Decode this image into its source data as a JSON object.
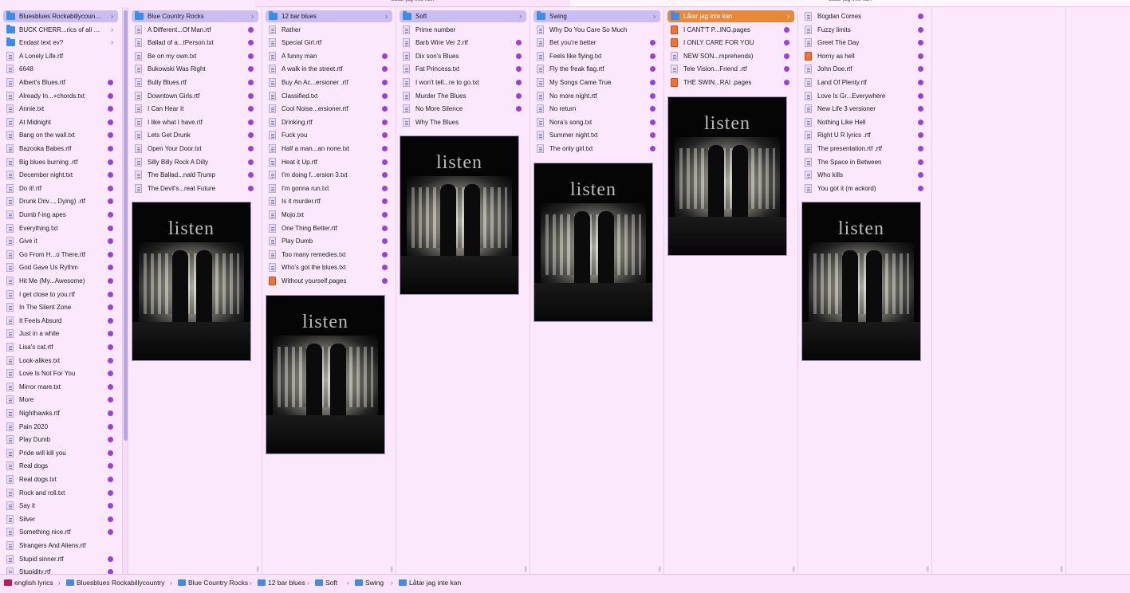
{
  "window": {
    "top_header_left": "Låtar jag inte kan",
    "top_header_right": "Låtar jag inte kan"
  },
  "colors": {
    "accent_tag": "#9b3fe0",
    "selection": "#c9bdf3",
    "selection_active": "#e8893a",
    "folder": "#3a8ee8"
  },
  "col0": {
    "items": [
      {
        "label": "Bluesblues Rockabillycountry",
        "kind": "folder",
        "chev": "›",
        "sel": true
      },
      {
        "label": "BUCK CHERR...rics of all sorts",
        "kind": "folder",
        "chev": "›"
      },
      {
        "label": "Endast text ev?",
        "kind": "folder",
        "chev": "›"
      },
      {
        "label": "A Lonely Life.rtf",
        "kind": "doc"
      },
      {
        "label": "6648",
        "kind": "doc"
      },
      {
        "label": "Albert's Blues.rtf",
        "kind": "doc",
        "tag": true
      },
      {
        "label": "Already In...+chords.txt",
        "kind": "doc",
        "tag": true
      },
      {
        "label": "Annie.txt",
        "kind": "doc",
        "tag": true
      },
      {
        "label": "At Midnight",
        "kind": "doc",
        "tag": true
      },
      {
        "label": "Bang on the wall.txt",
        "kind": "doc",
        "tag": true
      },
      {
        "label": "Bazooka Babes.rtf",
        "kind": "doc",
        "tag": true
      },
      {
        "label": "Big blues burning .rtf",
        "kind": "doc",
        "tag": true
      },
      {
        "label": "December night.txt",
        "kind": "doc",
        "tag": true
      },
      {
        "label": "Do it!.rtf",
        "kind": "doc",
        "tag": true
      },
      {
        "label": "Drunk Driv..., Dying) .rtf",
        "kind": "doc",
        "tag": true
      },
      {
        "label": "Dumb f-ing apes",
        "kind": "doc",
        "tag": true
      },
      {
        "label": "Everything.txt",
        "kind": "doc",
        "tag": true
      },
      {
        "label": "Give it",
        "kind": "doc",
        "tag": true
      },
      {
        "label": "Go From H...o There.rtf",
        "kind": "doc",
        "tag": true
      },
      {
        "label": "God Gave Us Rythm",
        "kind": "doc",
        "tag": true
      },
      {
        "label": "Hit Me (My...Awesome)",
        "kind": "doc",
        "tag": true
      },
      {
        "label": "I get close to you.rtf",
        "kind": "doc",
        "tag": true
      },
      {
        "label": "In The Silent Zone",
        "kind": "doc",
        "tag": true
      },
      {
        "label": "It Feels Absurd",
        "kind": "doc",
        "tag": true
      },
      {
        "label": "Just in a while",
        "kind": "doc",
        "tag": true
      },
      {
        "label": "Lisa's cat.rtf",
        "kind": "doc",
        "tag": true
      },
      {
        "label": "Look-alikes.txt",
        "kind": "doc",
        "tag": true
      },
      {
        "label": "Love Is Not For You",
        "kind": "doc",
        "tag": true
      },
      {
        "label": "Mirror mare.txt",
        "kind": "doc",
        "tag": true
      },
      {
        "label": "More",
        "kind": "doc",
        "tag": true
      },
      {
        "label": "Nighthawks.rtf",
        "kind": "doc",
        "tag": true
      },
      {
        "label": "Pain 2020",
        "kind": "doc",
        "tag": true
      },
      {
        "label": "Play Dumb",
        "kind": "doc",
        "tag": true
      },
      {
        "label": "Pride will kill you",
        "kind": "doc",
        "tag": true
      },
      {
        "label": "Real dogs",
        "kind": "doc",
        "tag": true
      },
      {
        "label": "Real dogs.txt",
        "kind": "doc",
        "tag": true
      },
      {
        "label": "Rock and roll.txt",
        "kind": "doc",
        "tag": true
      },
      {
        "label": "Say it",
        "kind": "doc",
        "tag": true
      },
      {
        "label": "Silver",
        "kind": "doc",
        "tag": true
      },
      {
        "label": "Something nice.rtf",
        "kind": "doc",
        "tag": true
      },
      {
        "label": "Strangers And Aliens.rtf",
        "kind": "doc"
      },
      {
        "label": "Stupid sinner.rtf",
        "kind": "doc",
        "tag": true
      },
      {
        "label": "Stupidity.rtf",
        "kind": "doc",
        "tag": true
      }
    ]
  },
  "col1": {
    "items": [
      {
        "label": "Blue Country Rocks",
        "kind": "folder",
        "chev": "›",
        "sel": true
      },
      {
        "label": "A Different...Of Man.rtf",
        "kind": "doc",
        "tag": true
      },
      {
        "label": "Ballad of a...tPerson.txt",
        "kind": "doc",
        "tag": true
      },
      {
        "label": "Be on my own.txt",
        "kind": "doc",
        "tag": true
      },
      {
        "label": "Bukowski Was Right",
        "kind": "doc",
        "tag": true
      },
      {
        "label": "Bully Blues.rtf",
        "kind": "doc",
        "tag": true
      },
      {
        "label": "Downtown Girls.rtf",
        "kind": "doc",
        "tag": true
      },
      {
        "label": "I Can Hear It",
        "kind": "doc",
        "tag": true
      },
      {
        "label": "I like what I have.rtf",
        "kind": "doc",
        "tag": true
      },
      {
        "label": "Lets Get Drunk",
        "kind": "doc",
        "tag": true
      },
      {
        "label": "Open Your Door.txt",
        "kind": "doc",
        "tag": true
      },
      {
        "label": "Silly Billy Rock A Dilly",
        "kind": "doc",
        "tag": true
      },
      {
        "label": "The Ballad...nald Trump",
        "kind": "doc",
        "tag": true
      },
      {
        "label": "The Devil's...reat Future",
        "kind": "doc",
        "tag": true
      }
    ],
    "preview_title": "listen"
  },
  "col2": {
    "items": [
      {
        "label": "12 bar blues",
        "kind": "folder",
        "chev": "›",
        "sel": true
      },
      {
        "label": "Rather",
        "kind": "doc"
      },
      {
        "label": "Special Girl.rtf",
        "kind": "doc"
      },
      {
        "label": "A funny man",
        "kind": "doc",
        "tag": true
      },
      {
        "label": "A walk in the street.rtf",
        "kind": "doc",
        "tag": true
      },
      {
        "label": "Buy An Ac...ersioner .rtf",
        "kind": "doc",
        "tag": true
      },
      {
        "label": "Classified.txt",
        "kind": "doc",
        "tag": true
      },
      {
        "label": "Cool Noise...ersioner.rtf",
        "kind": "doc",
        "tag": true
      },
      {
        "label": "Drinking.rtf",
        "kind": "doc",
        "tag": true
      },
      {
        "label": "Fuck you",
        "kind": "doc",
        "tag": true
      },
      {
        "label": "Half a man...an none.txt",
        "kind": "doc",
        "tag": true
      },
      {
        "label": "Heat it Up.rtf",
        "kind": "doc",
        "tag": true
      },
      {
        "label": "I'm doing f...ersion 3.txt",
        "kind": "doc",
        "tag": true
      },
      {
        "label": "I'm gonna run.txt",
        "kind": "doc",
        "tag": true
      },
      {
        "label": "Is it murder.rtf",
        "kind": "doc",
        "tag": true
      },
      {
        "label": "Mojo.txt",
        "kind": "doc",
        "tag": true
      },
      {
        "label": "One Thing Better.rtf",
        "kind": "doc",
        "tag": true
      },
      {
        "label": "Play Dumb",
        "kind": "doc",
        "tag": true
      },
      {
        "label": "Too many remedies.txt",
        "kind": "doc",
        "tag": true
      },
      {
        "label": "Who's got the blues.txt",
        "kind": "doc",
        "tag": true
      },
      {
        "label": "Without yourself.pages",
        "kind": "pages",
        "tag": true
      }
    ],
    "preview_title": "listen"
  },
  "col3": {
    "items": [
      {
        "label": "Soft",
        "kind": "folder",
        "chev": "›",
        "sel": true
      },
      {
        "label": "Prime number",
        "kind": "doc"
      },
      {
        "label": "Barb Wire Ver 2.rtf",
        "kind": "doc",
        "tag": true
      },
      {
        "label": "Dix son's Blues",
        "kind": "doc",
        "tag": true
      },
      {
        "label": "Fat Princess.txt",
        "kind": "doc",
        "tag": true
      },
      {
        "label": "I won't tell...re to go.txt",
        "kind": "doc",
        "tag": true
      },
      {
        "label": "Murder The Blues",
        "kind": "doc",
        "tag": true
      },
      {
        "label": "No More Silence",
        "kind": "doc",
        "tag": true
      },
      {
        "label": "Why The Blues",
        "kind": "doc"
      }
    ],
    "preview_title": "listen"
  },
  "col4": {
    "items": [
      {
        "label": "Swing",
        "kind": "folder",
        "chev": "›",
        "sel": true
      },
      {
        "label": "Why Do You Care So Much",
        "kind": "doc"
      },
      {
        "label": "Bet you're better",
        "kind": "doc",
        "tag": true
      },
      {
        "label": "Feels like flying.txt",
        "kind": "doc",
        "tag": true
      },
      {
        "label": "Fly the freak flag.rtf",
        "kind": "doc",
        "tag": true
      },
      {
        "label": "My Songs Came True",
        "kind": "doc",
        "tag": true
      },
      {
        "label": "No more night.rtf",
        "kind": "doc",
        "tag": true
      },
      {
        "label": "No return",
        "kind": "doc",
        "tag": true
      },
      {
        "label": "Nora's song.txt",
        "kind": "doc",
        "tag": true
      },
      {
        "label": "Summer night.txt",
        "kind": "doc",
        "tag": true
      },
      {
        "label": "The only girl.txt",
        "kind": "doc",
        "tag": true
      }
    ],
    "preview_title": "listen"
  },
  "col5": {
    "items": [
      {
        "label": "Låtar jag inte kan",
        "kind": "folder",
        "chev": "›",
        "active": true
      },
      {
        "label": "I CANT'T P...ING.pages",
        "kind": "pages",
        "tag": true
      },
      {
        "label": "I ONLY CARE FOR YOU",
        "kind": "pages",
        "tag": true
      },
      {
        "label": "NEW SON...mprehends)",
        "kind": "doc",
        "tag": true
      },
      {
        "label": "Tele Vision...Friend .rtf",
        "kind": "doc",
        "tag": true
      },
      {
        "label": "THE SWIN...RAI .pages",
        "kind": "pages",
        "tag": true
      }
    ],
    "preview_title": "listen"
  },
  "col6": {
    "items": [
      {
        "label": "Bogdan Comes",
        "kind": "doc",
        "tag": true
      },
      {
        "label": "Fuzzy limits",
        "kind": "doc",
        "tag": true
      },
      {
        "label": "Greet The Day",
        "kind": "doc",
        "tag": true
      },
      {
        "label": "Horny as hell",
        "kind": "pages",
        "tag": true
      },
      {
        "label": "John Doe.rtf",
        "kind": "doc",
        "tag": true
      },
      {
        "label": "Land Of Plenty.rtf",
        "kind": "doc",
        "tag": true
      },
      {
        "label": "Love Is Gr...Everywhere",
        "kind": "doc",
        "tag": true
      },
      {
        "label": "New Life 3 versioner",
        "kind": "doc",
        "tag": true
      },
      {
        "label": "Nothing Like Hell",
        "kind": "doc",
        "tag": true
      },
      {
        "label": "Right U R lyrics .rtf",
        "kind": "doc",
        "tag": true
      },
      {
        "label": "The presentation.rtf .rtf",
        "kind": "doc",
        "tag": true
      },
      {
        "label": "The Space in Between",
        "kind": "doc",
        "tag": true
      },
      {
        "label": "Who kills",
        "kind": "doc",
        "tag": true
      },
      {
        "label": "You got it (m ackord)",
        "kind": "doc",
        "tag": true
      }
    ],
    "preview_title": "listen"
  },
  "pathbar": {
    "crumbs": [
      {
        "label": "english lyrics",
        "icon": "red"
      },
      {
        "label": "Bluesblues Rockabillycountry",
        "icon": "folder"
      },
      {
        "label": "Blue Country Rocks",
        "icon": "folder"
      },
      {
        "label": "12 bar blues",
        "icon": "folder"
      },
      {
        "label": "Soft",
        "icon": "folder"
      },
      {
        "label": "Swing",
        "icon": "folder"
      },
      {
        "label": "Låtar jag inte kan",
        "icon": "folder"
      }
    ],
    "separator": "›"
  }
}
